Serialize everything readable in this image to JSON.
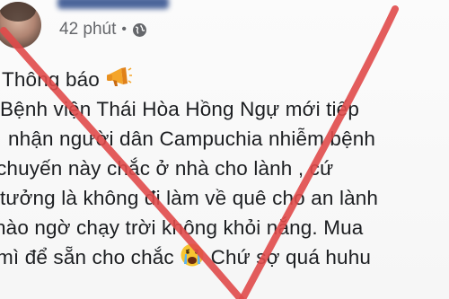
{
  "post": {
    "author_time": "42 phút",
    "separator": "•",
    "privacy_icon": "globe-icon",
    "lines": [
      "Thông báo",
      "Bệnh viện Thái Hòa Hồng Ngự mới tiếp",
      "nhận người dân Campuchia nhiễm bệnh",
      "chuyến này chắc ở nhà cho lành , cứ",
      "tưởng là không đi làm về quê cho an lành",
      "nào ngờ chạy trời không khỏi nắng. Mua",
      "mì để sẵn cho chắc",
      "Chứ sợ quá huhu"
    ],
    "emojis": [
      "megaphone-icon",
      "crying-face-icon"
    ]
  },
  "colors": {
    "cross_mark": "#e04a4a",
    "meta_text": "#65676b",
    "body_text": "#1c1e21"
  }
}
